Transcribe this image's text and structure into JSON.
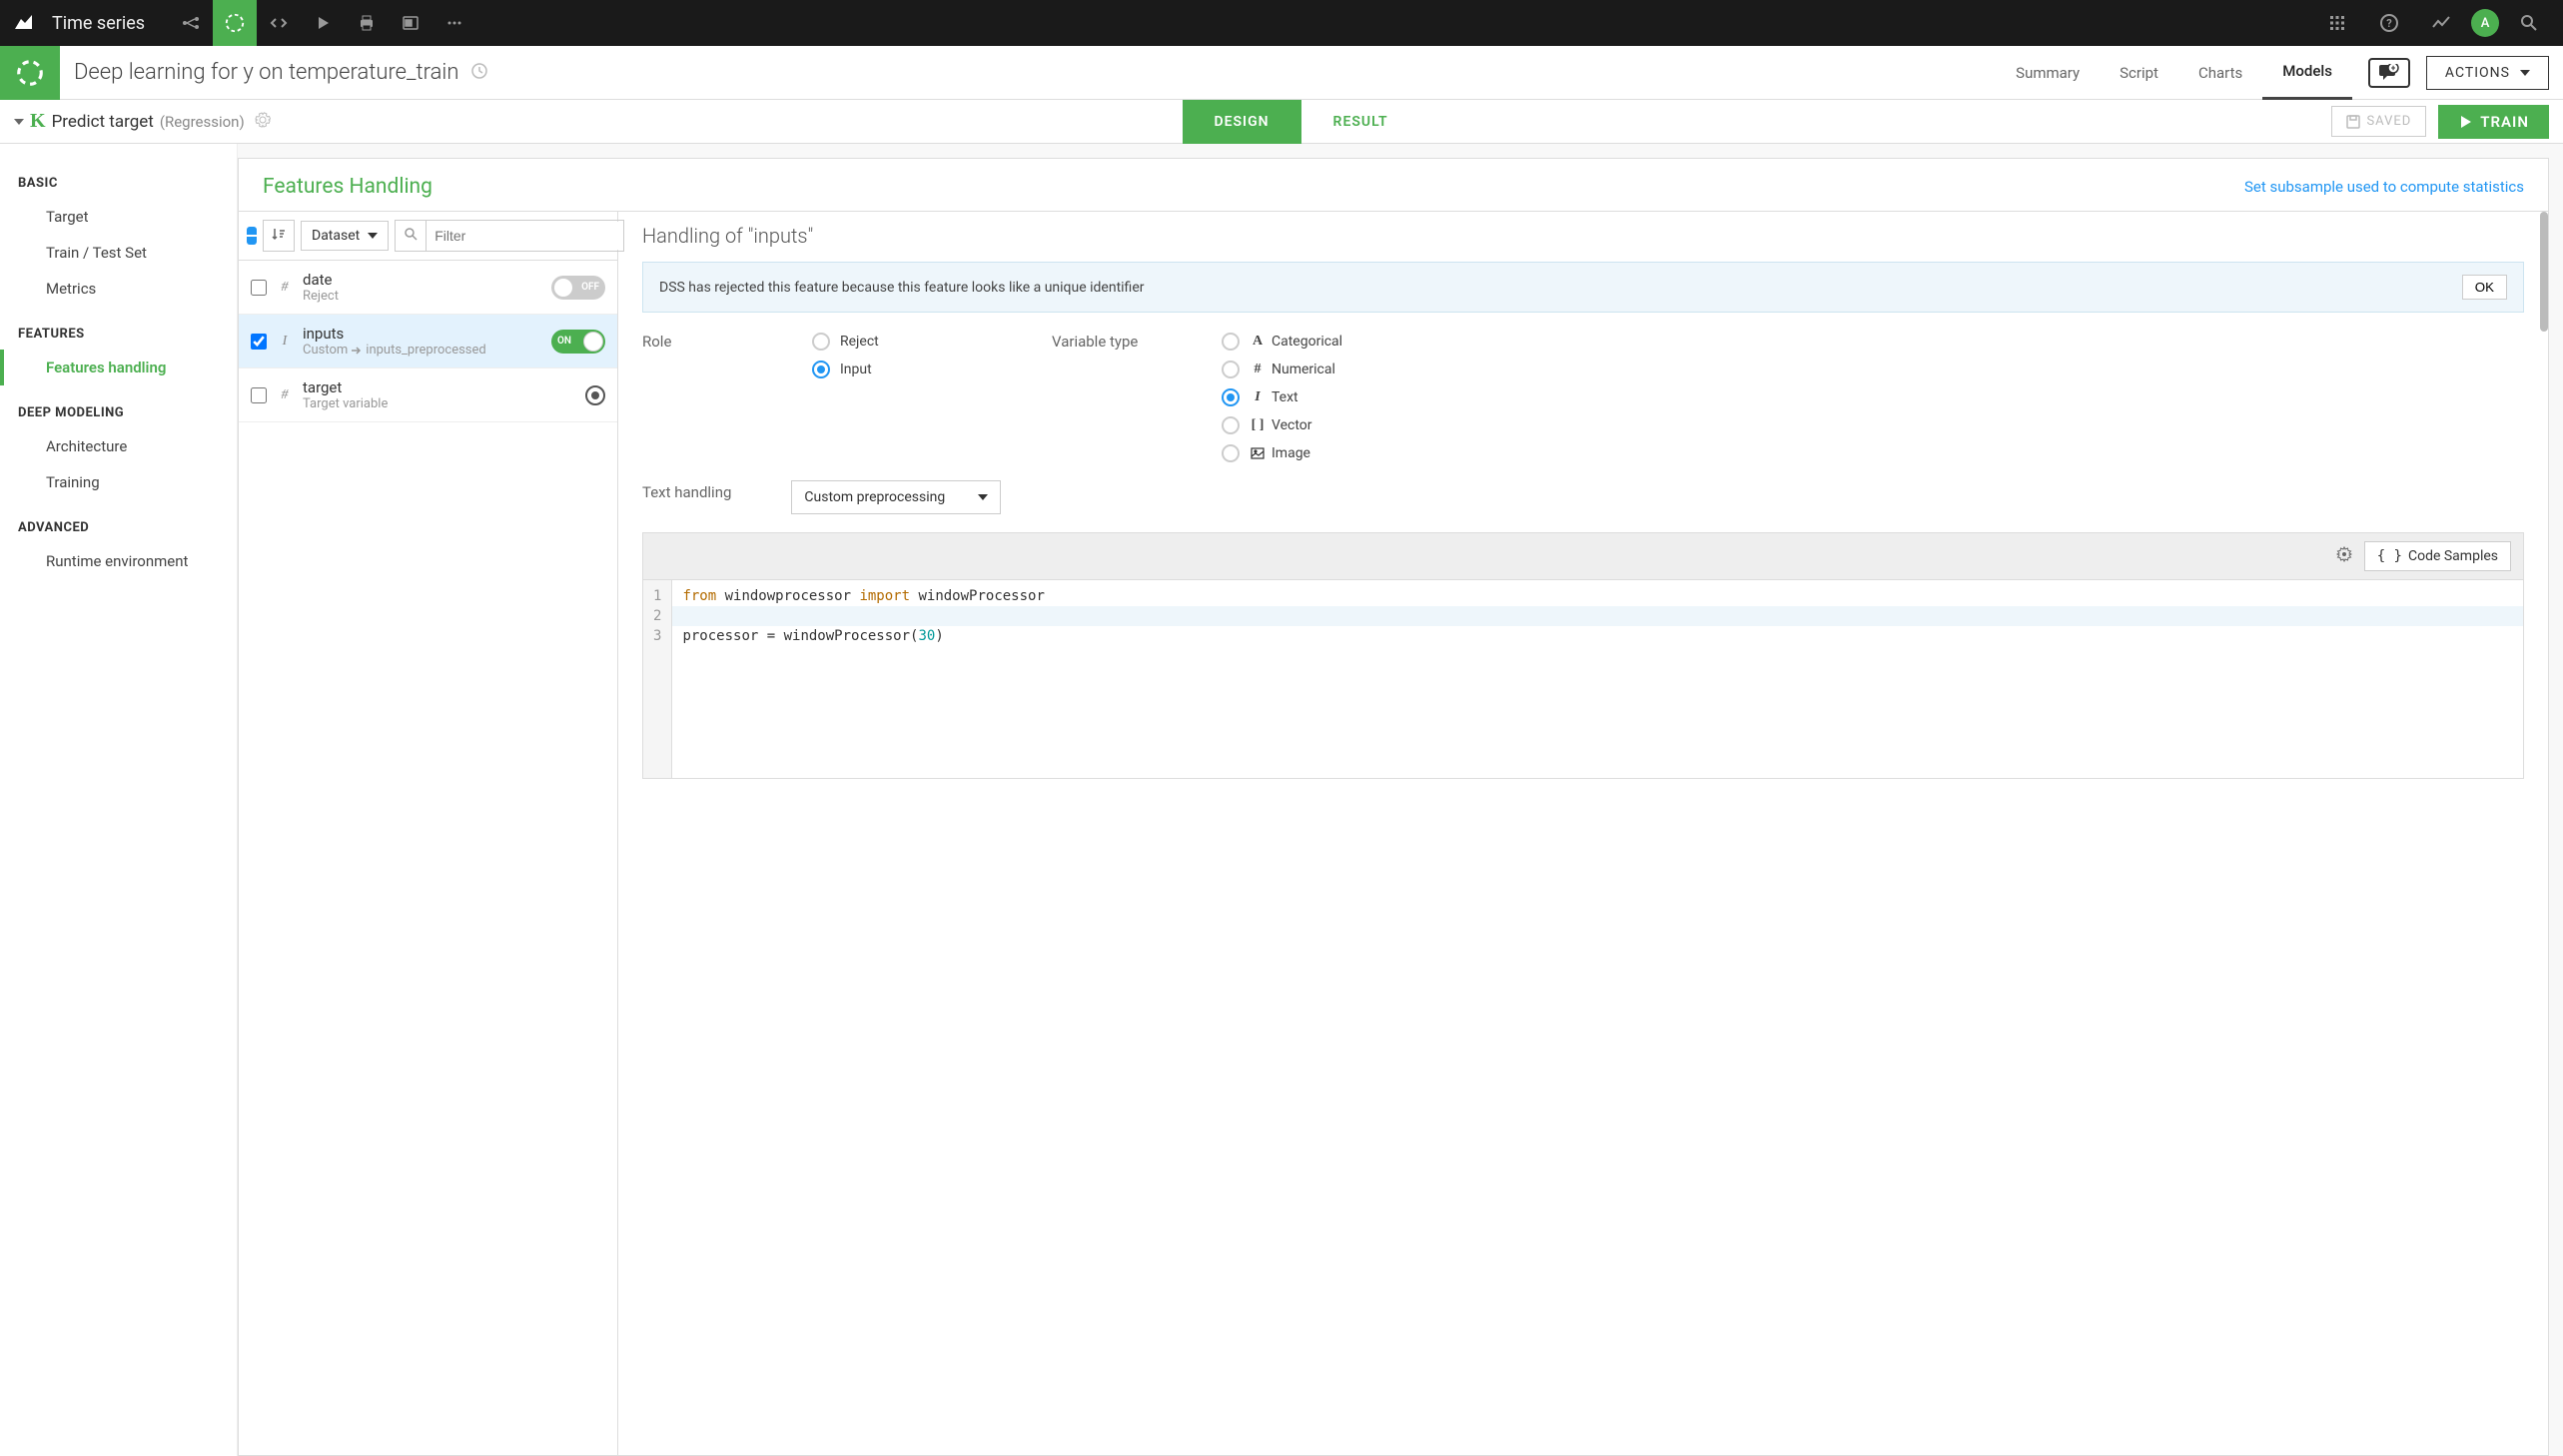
{
  "topbar": {
    "project_name": "Time series",
    "avatar_letter": "A"
  },
  "header": {
    "title": "Deep learning for y on temperature_train",
    "tabs": [
      "Summary",
      "Script",
      "Charts",
      "Models"
    ],
    "active_tab": "Models",
    "actions_label": "ACTIONS"
  },
  "subheader": {
    "badge": "K",
    "title": "Predict target",
    "subtitle": "(Regression)",
    "design_label": "DESIGN",
    "result_label": "RESULT",
    "saved_label": "SAVED",
    "train_label": "TRAIN"
  },
  "sidebar": {
    "sections": [
      {
        "heading": "BASIC",
        "items": [
          "Target",
          "Train / Test Set",
          "Metrics"
        ]
      },
      {
        "heading": "FEATURES",
        "items": [
          "Features handling"
        ],
        "active": "Features handling"
      },
      {
        "heading": "DEEP MODELING",
        "items": [
          "Architecture",
          "Training"
        ]
      },
      {
        "heading": "ADVANCED",
        "items": [
          "Runtime environment"
        ]
      }
    ]
  },
  "panel": {
    "title": "Features Handling",
    "link": "Set subsample used to compute statistics",
    "dataset_label": "Dataset",
    "filter_placeholder": "Filter"
  },
  "features": [
    {
      "name": "date",
      "sub": "Reject",
      "type": "#",
      "checked": false,
      "toggle": "OFF",
      "selected": false
    },
    {
      "name": "inputs",
      "sub": "Custom",
      "sub2": "inputs_preprocessed",
      "type": "I",
      "checked": true,
      "toggle": "ON",
      "selected": true
    },
    {
      "name": "target",
      "sub": "Target variable",
      "type": "#",
      "checked": false,
      "is_target": true,
      "selected": false
    }
  ],
  "detail": {
    "title": "Handling of \"inputs\"",
    "info_text": "DSS has rejected this feature because this feature looks like a unique identifier",
    "ok_label": "OK",
    "role_label": "Role",
    "role_options": [
      "Reject",
      "Input"
    ],
    "role_selected": "Input",
    "vartype_label": "Variable type",
    "vartype_options": [
      {
        "icon": "A",
        "label": "Categorical"
      },
      {
        "icon": "#",
        "label": "Numerical"
      },
      {
        "icon": "I",
        "label": "Text"
      },
      {
        "icon": "[ ]",
        "label": "Vector"
      },
      {
        "icon": "img",
        "label": "Image"
      }
    ],
    "vartype_selected": "Text",
    "text_handling_label": "Text handling",
    "text_handling_value": "Custom preprocessing",
    "code_samples_label": "Code Samples",
    "code": {
      "line1_from": "from",
      "line1_mod": " windowprocessor ",
      "line1_import": "import",
      "line1_name": " windowProcessor",
      "line3_a": "processor = windowProcessor(",
      "line3_num": "30",
      "line3_b": ")"
    }
  }
}
